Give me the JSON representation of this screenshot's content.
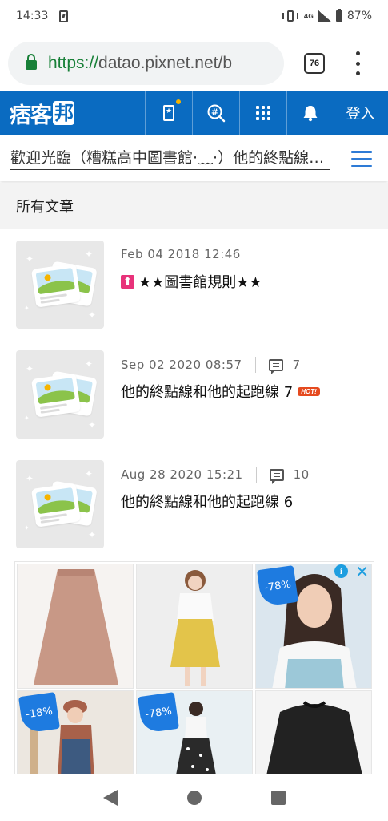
{
  "status_bar": {
    "time": "14:33",
    "network": "4G",
    "battery": "87%"
  },
  "browser": {
    "url_scheme": "https://",
    "url_rest": "datao.pixnet.net/b",
    "tab_count": "76"
  },
  "pixnet": {
    "logo_text": "痞客",
    "logo_box": "邦",
    "login_label": "登入"
  },
  "blog": {
    "title": "歡迎光臨（糟糕高中圖書館·﹏·）他的終點線和他的起跑線"
  },
  "section": {
    "title": "所有文章"
  },
  "articles": [
    {
      "date": "Feb 04 2018 12:46",
      "comments": "",
      "pinned": true,
      "title": "★★圖書館規則★★",
      "hot": false
    },
    {
      "date": "Sep 02 2020 08:57",
      "comments": "7",
      "pinned": false,
      "title": "他的終點線和他的起跑線 7",
      "hot": true
    },
    {
      "date": "Aug 28 2020 15:21",
      "comments": "10",
      "pinned": false,
      "title": "他的終點線和他的起跑線 6",
      "hot": false
    }
  ],
  "hot_badge": "HOT!",
  "pin_glyph": "⬆",
  "ads": [
    {
      "discount": "",
      "color": "#c89886"
    },
    {
      "discount": "",
      "color": "#e3c44a"
    },
    {
      "discount": "-78%",
      "color": "#9cc8d8"
    },
    {
      "discount": "-18%",
      "color": "#a8614a"
    },
    {
      "discount": "-78%",
      "color": "#d8d4cc"
    },
    {
      "discount": "",
      "color": "#222222"
    }
  ],
  "ad_info_glyph": "i",
  "ad_close_glyph": "✕",
  "colors": {
    "header_blue": "#0a6bc1",
    "accent_blue": "#2e7bd6",
    "url_green": "#188038"
  }
}
